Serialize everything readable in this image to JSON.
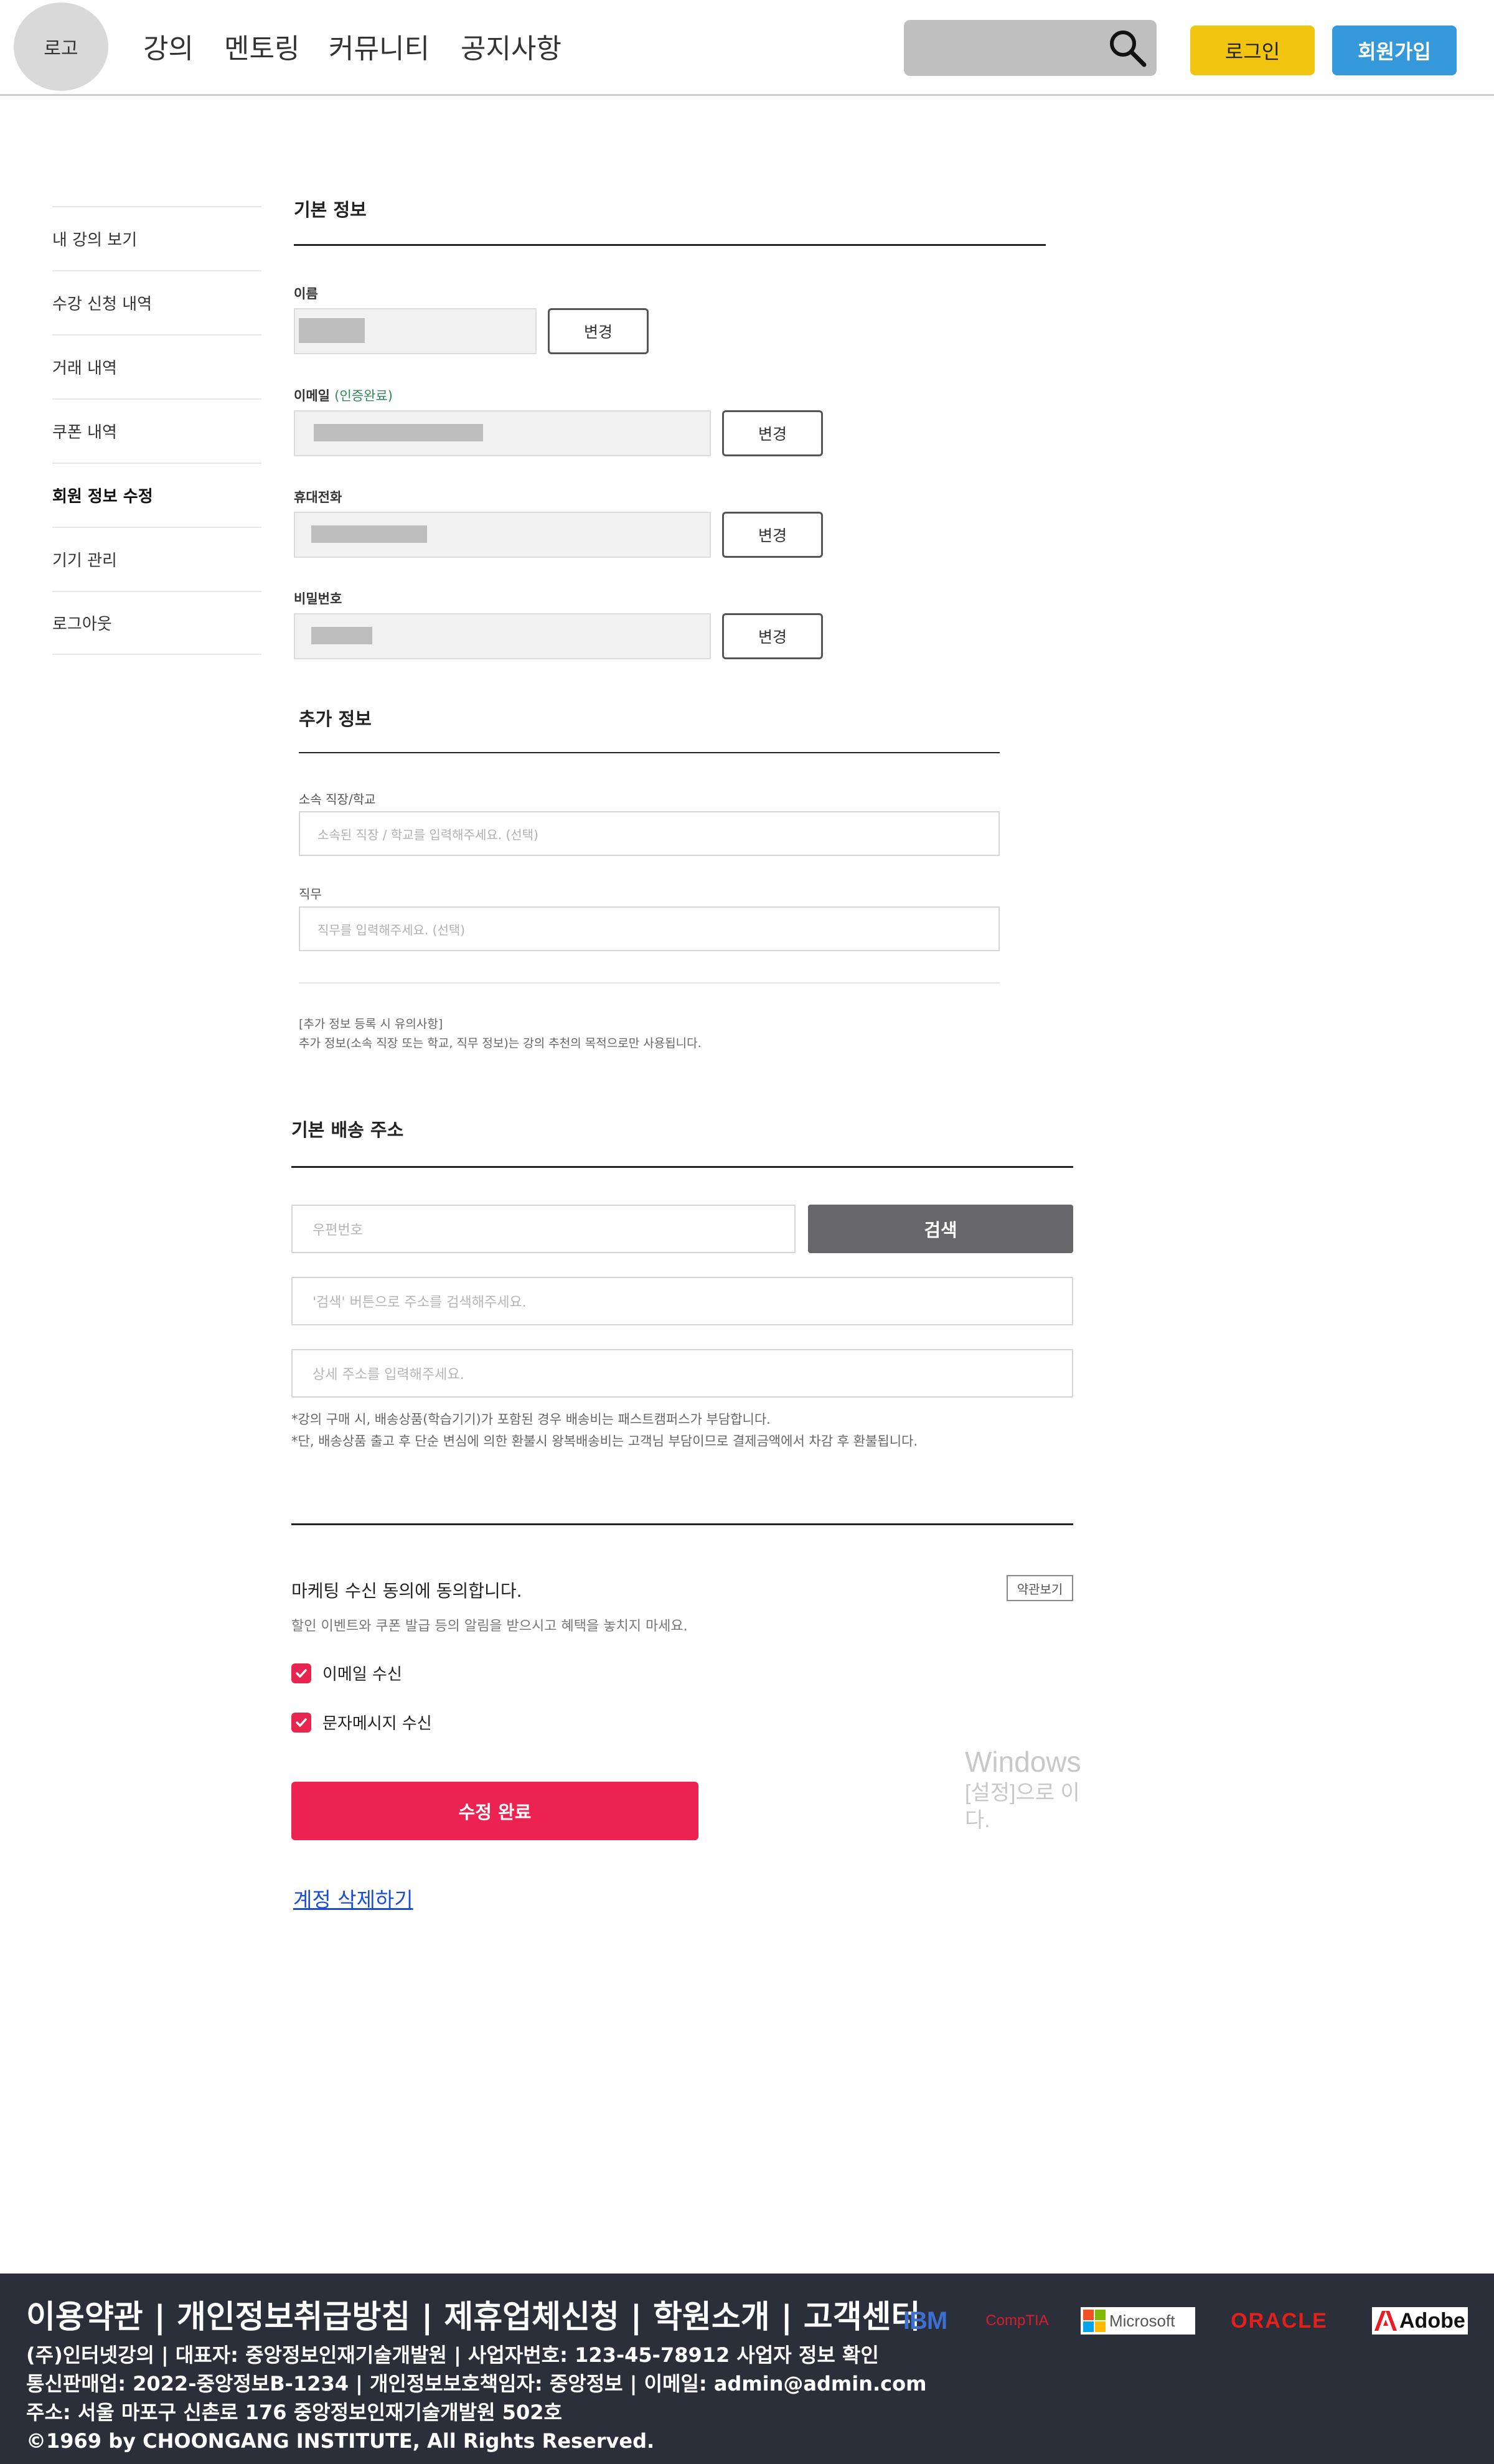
{
  "header": {
    "logo_text": "로고",
    "nav": [
      "강의",
      "멘토링",
      "커뮤니티",
      "공지사항"
    ],
    "search_placeholder": "",
    "login_label": "로그인",
    "signup_label": "회원가입",
    "colors": {
      "login": "#f1c40f",
      "signup": "#3498db"
    }
  },
  "sidebar": {
    "items": [
      {
        "label": "내 강의 보기",
        "active": false
      },
      {
        "label": "수강 신청 내역",
        "active": false
      },
      {
        "label": "거래 내역",
        "active": false
      },
      {
        "label": "쿠폰 내역",
        "active": false
      },
      {
        "label": "회원 정보 수정",
        "active": true
      },
      {
        "label": "기기 관리",
        "active": false
      },
      {
        "label": "로그아웃",
        "active": false
      }
    ]
  },
  "basic_info": {
    "title": "기본 정보",
    "name_label": "이름",
    "email_label": "이메일",
    "email_verified": "(인증완료)",
    "phone_label": "휴대전화",
    "password_label": "비밀번호",
    "change_label": "변경"
  },
  "extra_info": {
    "title": "추가 정보",
    "org_label": "소속 직장/학교",
    "org_placeholder": "소속된 직장 / 학교를 입력해주세요. (선택)",
    "job_label": "직무",
    "job_placeholder": "직무를 입력해주세요. (선택)",
    "note_title": "[추가 정보 등록 시 유의사항]",
    "note_text": "추가 정보(소속 직장 또는 학교, 직무 정보)는 강의 추천의 목적으로만 사용됩니다."
  },
  "address": {
    "title": "기본 배송 주소",
    "zip_placeholder": "우편번호",
    "search_label": "검색",
    "addr_placeholder": "'검색' 버튼으로 주소를 검색해주세요.",
    "detail_placeholder": "상세 주소를 입력해주세요.",
    "note1": "*강의 구매 시, 배송상품(학습기기)가 포함된 경우 배송비는 패스트캠퍼스가 부담합니다.",
    "note2": "*단, 배송상품 출고 후 단순 변심에 의한 환불시 왕복배송비는 고객님 부담이므로 결제금액에서 차감 후 환불됩니다."
  },
  "marketing": {
    "title": "마케팅 수신 동의에 동의합니다.",
    "terms_label": "약관보기",
    "subtitle": "할인 이벤트와 쿠폰 발급 등의 알림을 받으시고 혜택을 놓치지 마세요.",
    "email_opt": "이메일 수신",
    "sms_opt": "문자메시지 수신",
    "email_checked": true,
    "sms_checked": true,
    "check_color": "#e8254e"
  },
  "actions": {
    "submit_label": "수정 완료",
    "submit_color": "#ec2350",
    "delete_label": "계정 삭제하기"
  },
  "watermark": {
    "line1": "Windows",
    "line2": "[설정]으로 이동",
    "line2_wrap_a": "[설정]으로 이",
    "line2_wrap_b": "다."
  },
  "footer": {
    "links": "이용약관 | 개인정보취급방침 | 제휴업체신청 | 학원소개 | 고객센터",
    "info1": "(주)인터넷강의 | 대표자: 중앙정보인재기술개발원 | 사업자번호: 123-45-78912 사업자 정보 확인",
    "info2": "통신판매업: 2022-중앙정보B-1234 | 개인정보보호책임자: 중앙정보 | 이메일: admin@admin.com",
    "info3": "주소: 서울 마포구 신촌로 176 중앙정보인재기술개발원 502호",
    "info4": "©1969 by CHOONGANG INSTITUTE, All Rights Reserved.",
    "partners": [
      "IBM",
      "CompTIA",
      "Microsoft",
      "ORACLE",
      "Adobe"
    ],
    "bg_color": "#2b2f3a"
  }
}
